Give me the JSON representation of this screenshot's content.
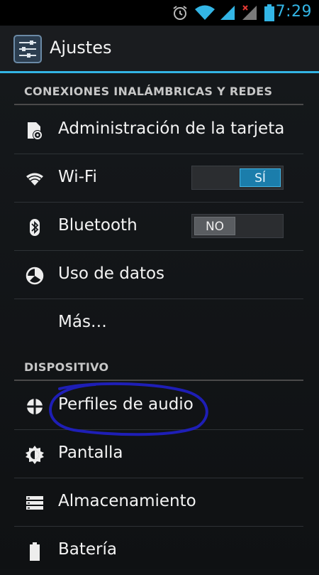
{
  "status_bar": {
    "time": "7:29",
    "icons": [
      "alarm-icon",
      "wifi-signal-icon",
      "cell-signal-icon",
      "cell-signal-no-service-icon",
      "battery-icon"
    ],
    "accent_color": "#33b5e5"
  },
  "action_bar": {
    "title": "Ajustes",
    "icon": "settings-sliders-icon"
  },
  "sections": {
    "wireless": {
      "header": "CONEXIONES INALÁMBRICAS Y REDES",
      "items": [
        {
          "label": "Administración de la tarjeta SIM",
          "icon": "sim-card-icon"
        },
        {
          "label": "Wi-Fi",
          "icon": "wifi-icon",
          "toggle": "SÍ"
        },
        {
          "label": "Bluetooth",
          "icon": "bluetooth-icon",
          "toggle": "NO"
        },
        {
          "label": "Uso de datos",
          "icon": "data-usage-icon"
        },
        {
          "label": "Más…"
        }
      ]
    },
    "device": {
      "header": "DISPOSITIVO",
      "items": [
        {
          "label": "Perfiles de audio",
          "icon": "audio-profiles-icon"
        },
        {
          "label": "Pantalla",
          "icon": "display-brightness-icon"
        },
        {
          "label": "Almacenamiento",
          "icon": "storage-icon"
        },
        {
          "label": "Batería",
          "icon": "battery-icon"
        }
      ]
    }
  },
  "colors": {
    "toggle_on": "#1b7dab",
    "toggle_off": "#5a5d61",
    "annotation_circle": "#2020c8"
  }
}
